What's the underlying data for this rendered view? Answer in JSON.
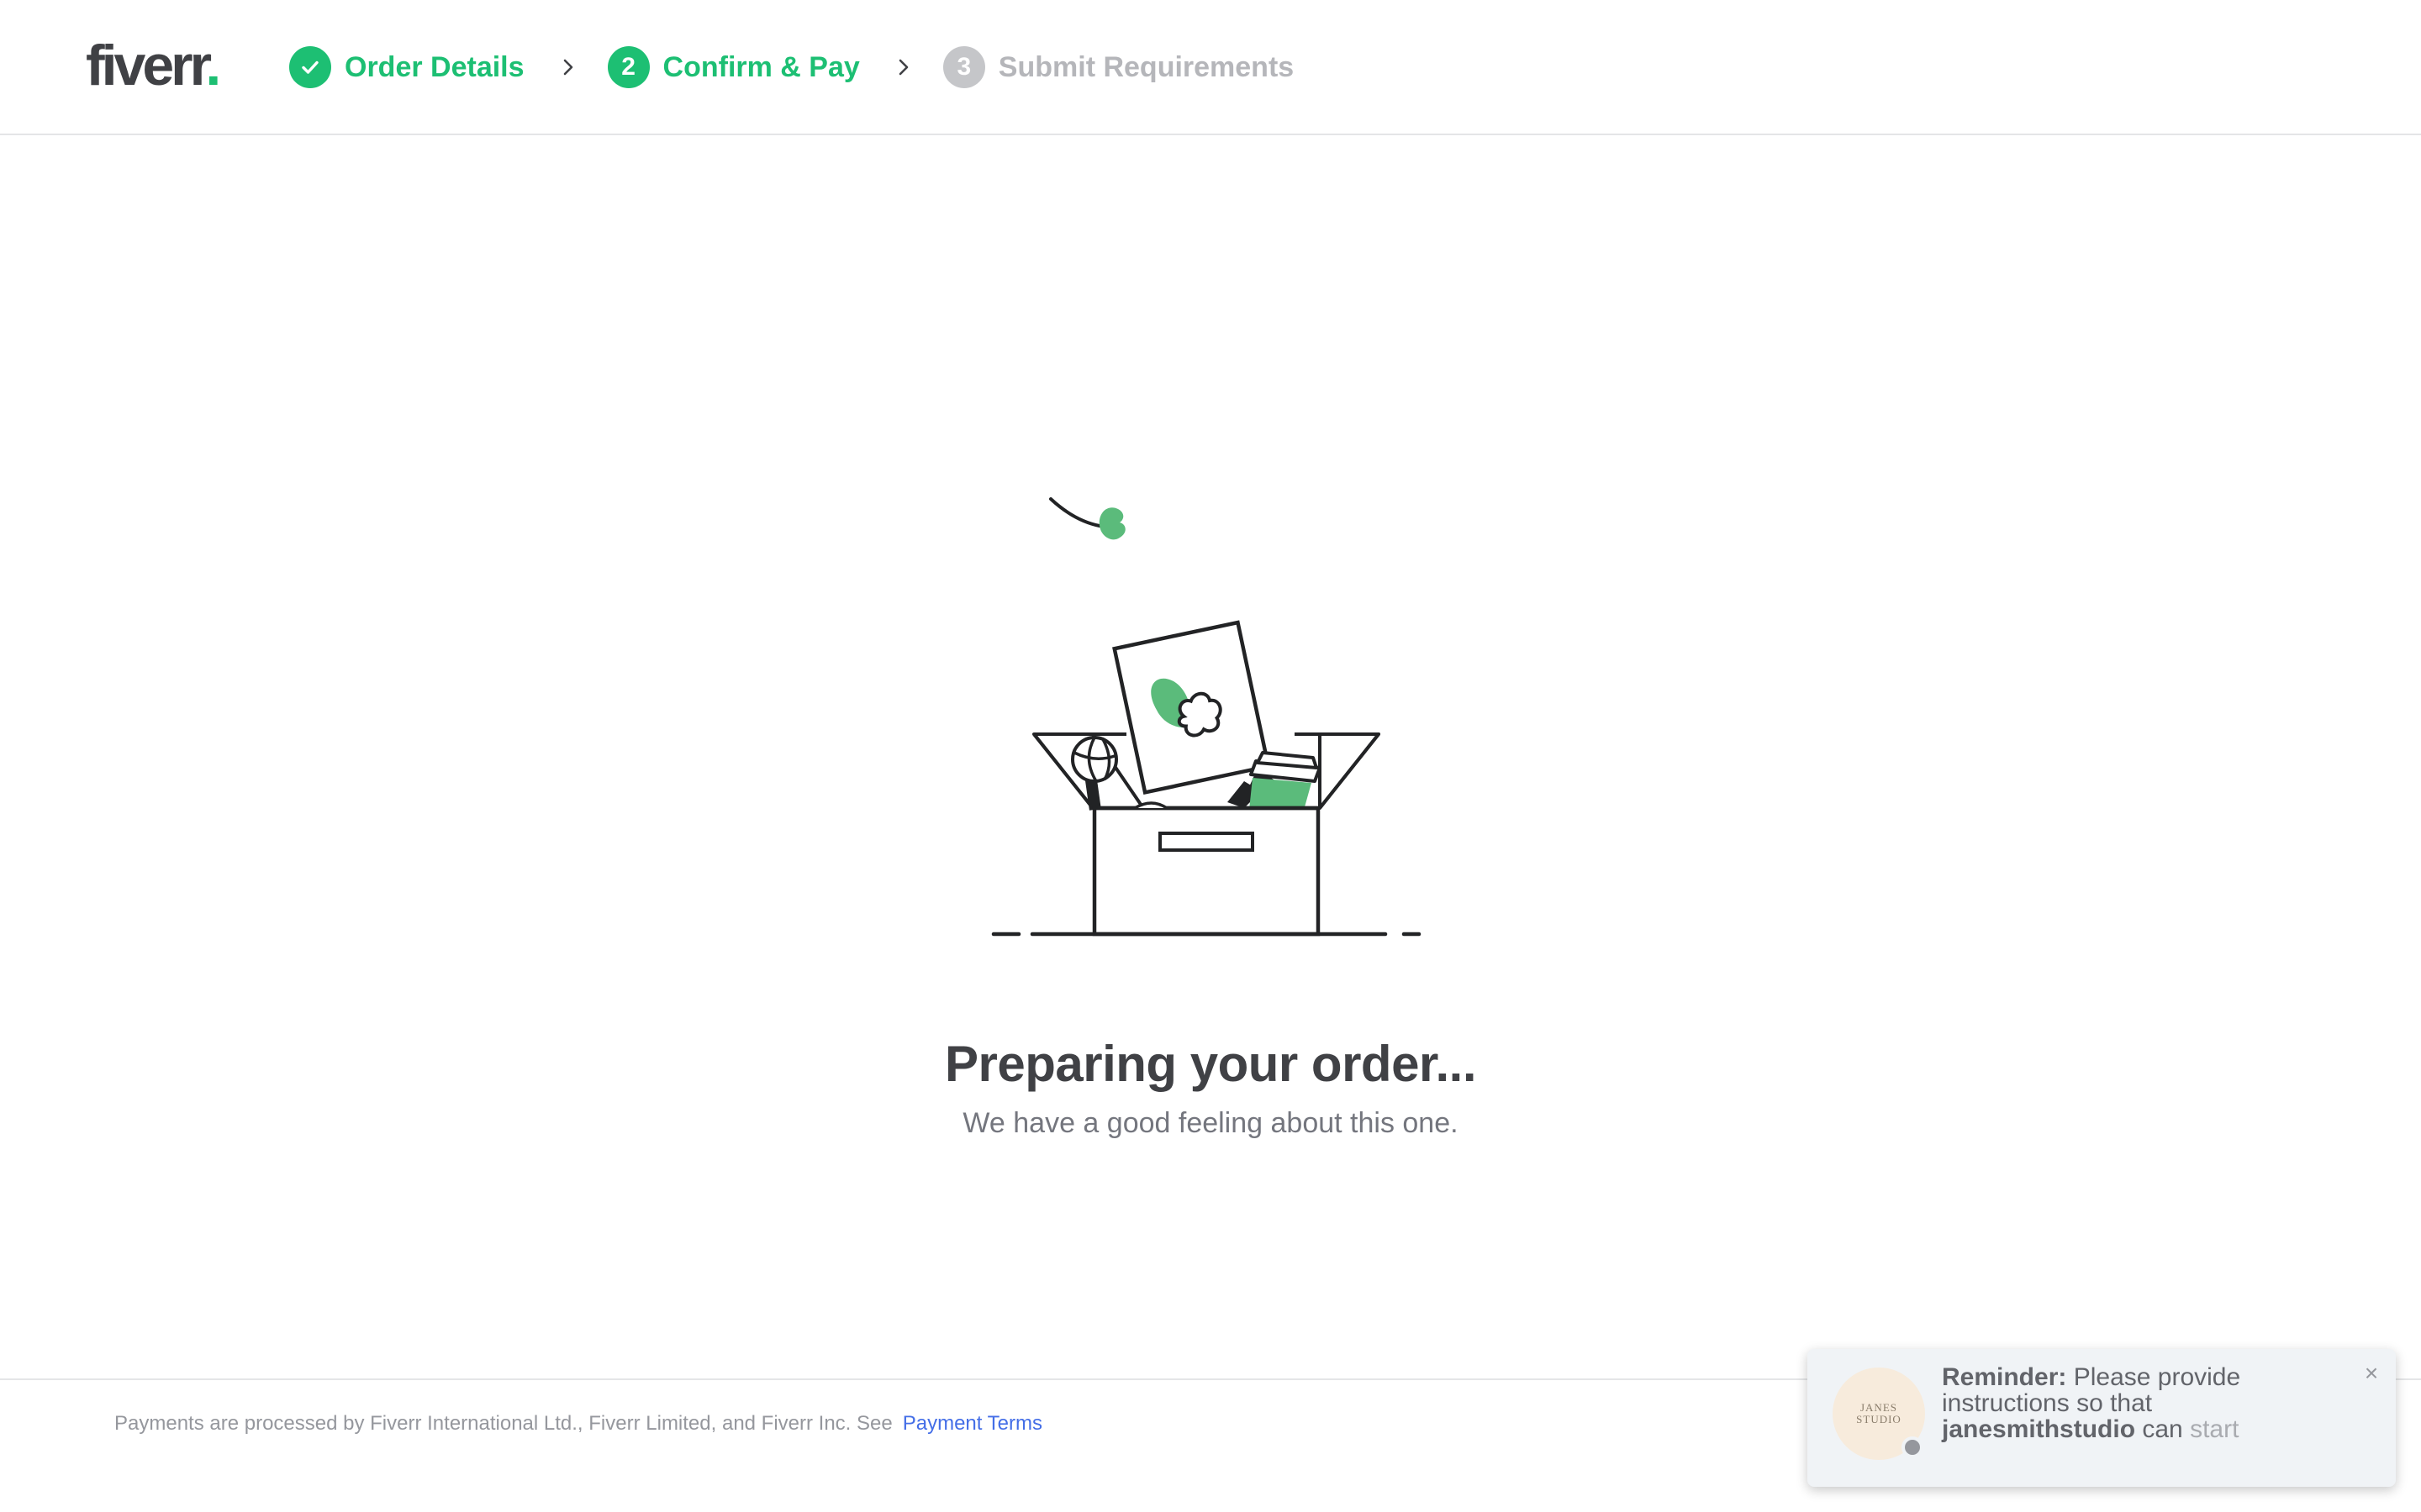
{
  "header": {
    "logo_text": "fiverr",
    "logo_dot": ".",
    "steps": [
      {
        "number": "✓",
        "label": "Order Details",
        "state": "done"
      },
      {
        "number": "2",
        "label": "Confirm & Pay",
        "state": "active"
      },
      {
        "number": "3",
        "label": "Submit Requirements",
        "state": "pending"
      }
    ]
  },
  "main": {
    "title": "Preparing your order...",
    "subtitle": "We have a good feeling about this one."
  },
  "footer": {
    "text": "Payments are processed by Fiverr International Ltd., Fiverr Limited, and Fiverr Inc. See",
    "link": "Payment Terms"
  },
  "toast": {
    "avatar_line1": "JANES",
    "avatar_line2": "STUDIO",
    "label": "Reminder:",
    "message": "Please provide instructions so that",
    "username": "janesmithstudio",
    "tail_1": "can",
    "tail_2": "start",
    "close": "×"
  },
  "colors": {
    "brand_green": "#1dbf73",
    "text_dark": "#404145",
    "link_blue": "#446ee7",
    "pending_gray": "#c5c6c9"
  }
}
